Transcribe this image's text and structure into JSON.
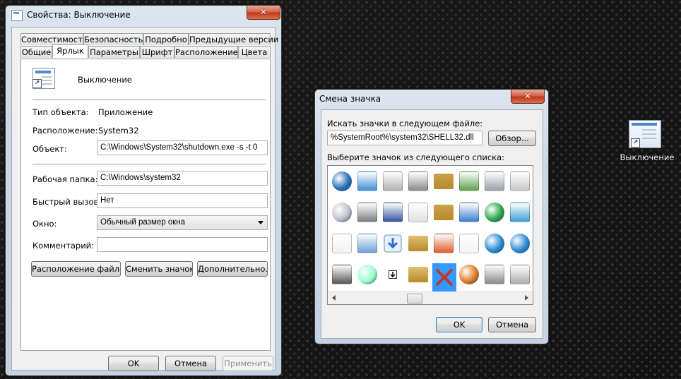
{
  "properties_window": {
    "title": "Свойства: Выключение",
    "close_label": "✕",
    "tabs_row1": [
      "Совместимость",
      "Безопасность",
      "Подробно",
      "Предыдущие версии"
    ],
    "tabs_row2": [
      "Общие",
      "Ярлык",
      "Параметры",
      "Шрифт",
      "Расположение",
      "Цвета"
    ],
    "active_tab": "Ярлык",
    "shortcut_name": "Выключение",
    "fields": {
      "type_label": "Тип объекта:",
      "type_value": "Приложение",
      "location_label": "Расположение:",
      "location_value": "System32",
      "target_label": "Объект:",
      "target_value": "C:\\Windows\\System32\\shutdown.exe -s -t 0",
      "workdir_label": "Рабочая папка:",
      "workdir_value": "C:\\Windows\\system32",
      "hotkey_label": "Быстрый вызов:",
      "hotkey_value": "Нет",
      "window_label": "Окно:",
      "window_value": "Обычный размер окна",
      "comment_label": "Комментарий:",
      "comment_value": ""
    },
    "buttons": {
      "file_location": "Расположение файла",
      "change_icon": "Сменить значок...",
      "advanced": "Дополнительно...",
      "ok": "OK",
      "cancel": "Отмена",
      "apply": "Применить"
    }
  },
  "change_icon_dialog": {
    "title": "Смена значка",
    "close_label": "✕",
    "file_label": "Искать значки в следующем файле:",
    "file_value": "%SystemRoot%\\system32\\SHELL32.dll",
    "browse_label": "Обзор...",
    "list_label": "Выберите значок из следующего списка:",
    "ok": "OK",
    "cancel": "Отмена",
    "icons": [
      [
        "power-icon",
        "music-file-icon",
        "mouse-icon",
        "drive-icon",
        "music-folder-icon",
        "file-export-icon",
        "printer-icon",
        "projector-icon"
      ],
      [
        "dvd-icon",
        "camera-icon",
        "disk-icon",
        "network-printer-icon",
        "music-folder-2-icon",
        "adjust-icon",
        "play-icon",
        "registry-icon"
      ],
      [
        "documents-icon",
        "image-file-icon",
        "download-icon",
        "folder-icon",
        "windows-flag-icon",
        "text-file-icon",
        "globe-icon",
        "globe-screen-icon"
      ],
      [
        "film-icon",
        "cd-icon",
        "small-arrow-icon",
        "folder-2-icon",
        "delete-x-icon",
        "globe-arrow-icon",
        "camera-2-icon",
        "scanner-icon"
      ]
    ],
    "selected_icon": "delete-x-icon"
  },
  "desktop": {
    "shortcut_label": "Выключение"
  }
}
